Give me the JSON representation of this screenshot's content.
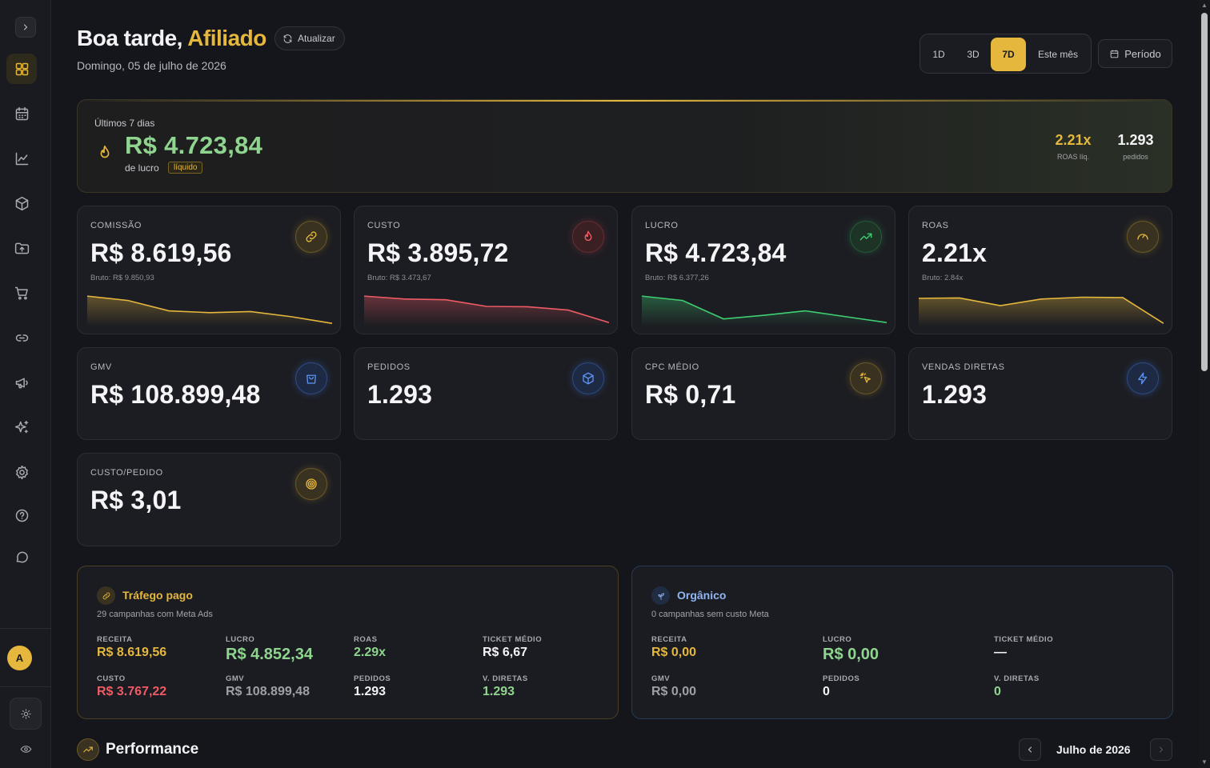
{
  "header": {
    "greeting": "Boa tarde,",
    "name": "Afiliado",
    "refresh_label": "Atualizar",
    "date": "Domingo, 05 de julho de 2026",
    "ranges": [
      "1D",
      "3D",
      "7D",
      "Este mês"
    ],
    "selected_range": "7D",
    "period_label": "Período"
  },
  "hero": {
    "period": "Últimos 7 dias",
    "value": "R$ 4.723,84",
    "sub": "de lucro",
    "tag": "líquido",
    "roas_value": "2.21x",
    "roas_label": "ROAS líq.",
    "orders_value": "1.293",
    "orders_label": "pedidos"
  },
  "cards": {
    "comissao": {
      "label": "COMISSÃO",
      "value": "R$ 8.619,56",
      "sub": "Bruto: R$ 9.850,93",
      "icon": "link-icon",
      "spark": [
        0.78,
        0.66,
        0.38,
        0.33,
        0.36,
        0.22,
        0.04
      ],
      "color": "#e5b73d"
    },
    "custo": {
      "label": "CUSTO",
      "value": "R$ 3.895,72",
      "sub": "Bruto: R$ 3.473,67",
      "icon": "flame-icon",
      "spark": [
        0.78,
        0.7,
        0.68,
        0.5,
        0.49,
        0.4,
        0.06
      ],
      "color": "#ef5b65"
    },
    "lucro": {
      "label": "LUCRO",
      "value": "R$ 4.723,84",
      "sub": "Bruto: R$ 6.377,26",
      "icon": "trending-up-icon",
      "spark": [
        0.78,
        0.66,
        0.16,
        0.26,
        0.38,
        0.22,
        0.06
      ],
      "color": "#3fcf73"
    },
    "roas": {
      "label": "ROAS",
      "value": "2.21x",
      "sub": "Bruto: 2.84x",
      "icon": "gauge-icon",
      "spark": [
        0.72,
        0.73,
        0.52,
        0.7,
        0.75,
        0.74,
        0.04
      ],
      "color": "#e5b73d"
    },
    "gmv": {
      "label": "GMV",
      "value": "R$ 108.899,48",
      "icon": "shopping-bag-icon"
    },
    "pedidos": {
      "label": "PEDIDOS",
      "value": "1.293",
      "icon": "box-icon"
    },
    "cpc": {
      "label": "CPC MÉDIO",
      "value": "R$ 0,71",
      "icon": "cursor-click-icon"
    },
    "vendas": {
      "label": "VENDAS DIRETAS",
      "value": "1.293",
      "icon": "zap-icon"
    },
    "custo_pedido": {
      "label": "CUSTO/PEDIDO",
      "value": "R$ 3,01",
      "icon": "target-icon"
    }
  },
  "paid": {
    "title": "Tráfego pago",
    "sub": "29 campanhas com Meta Ads",
    "receita_label": "RECEITA",
    "receita": "R$ 8.619,56",
    "lucro_label": "LUCRO",
    "lucro": "R$ 4.852,34",
    "roas_label": "ROAS",
    "roas": "2.29x",
    "ticket_label": "TICKET MÉDIO",
    "ticket": "R$ 6,67",
    "custo_label": "CUSTO",
    "custo": "R$ 3.767,22",
    "gmv_label": "GMV",
    "gmv": "R$ 108.899,48",
    "pedidos_label": "PEDIDOS",
    "pedidos": "1.293",
    "vdiretas_label": "V. DIRETAS",
    "vdiretas": "1.293"
  },
  "organic": {
    "title": "Orgânico",
    "sub": "0 campanhas sem custo Meta",
    "receita_label": "RECEITA",
    "receita": "R$ 0,00",
    "lucro_label": "LUCRO",
    "lucro": "R$ 0,00",
    "ticket_label": "TICKET MÉDIO",
    "ticket": "—",
    "gmv_label": "GMV",
    "gmv": "R$ 0,00",
    "pedidos_label": "PEDIDOS",
    "pedidos": "0",
    "vdiretas_label": "V. DIRETAS",
    "vdiretas": "0"
  },
  "performance": {
    "title": "Performance",
    "month": "Julho de 2026"
  },
  "user": {
    "initial": "A"
  },
  "colors": {
    "accent": "#e5b73d",
    "green": "#8fd48f",
    "red": "#ef5b65",
    "blue": "#5b93f2"
  }
}
